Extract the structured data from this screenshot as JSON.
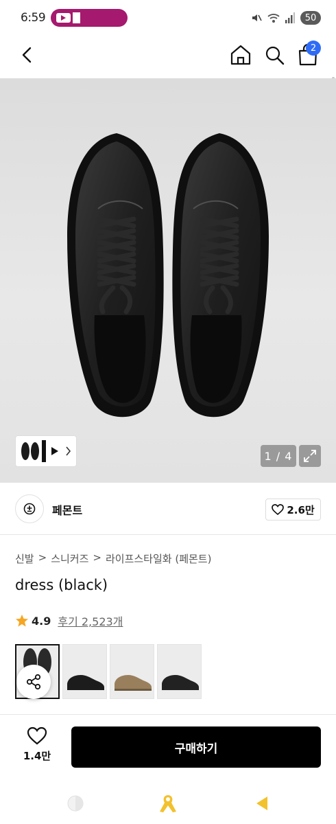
{
  "status_bar": {
    "time": "6:59",
    "battery": "50"
  },
  "nav": {
    "cart_count": "2"
  },
  "gallery": {
    "counter": "1 / 4"
  },
  "brand": {
    "name": "페몬트",
    "likes": "2.6만"
  },
  "breadcrumb": [
    "신발",
    "스니커즈",
    "라이프스타일화 (페몬트)"
  ],
  "breadcrumb_separator": ">",
  "product": {
    "title": "dress (black)",
    "rating": "4.9",
    "reviews": "후기 2,523개"
  },
  "variants": [
    {
      "name": "dress (black)",
      "color": "#2a2a2a",
      "selected": true
    },
    {
      "name": "black suede",
      "color": "#1c1c1c",
      "selected": false
    },
    {
      "name": "beige",
      "color": "#9a7f5c",
      "selected": false
    },
    {
      "name": "black",
      "color": "#222222",
      "selected": false
    }
  ],
  "bottom_bar": {
    "wish_count": "1.4만",
    "buy_label": "구매하기"
  },
  "colors": {
    "accent_blue": "#2f6cf6",
    "youtube_pill": "#a5196e",
    "star": "#f6a623",
    "ribbon": "#f2c12e"
  }
}
